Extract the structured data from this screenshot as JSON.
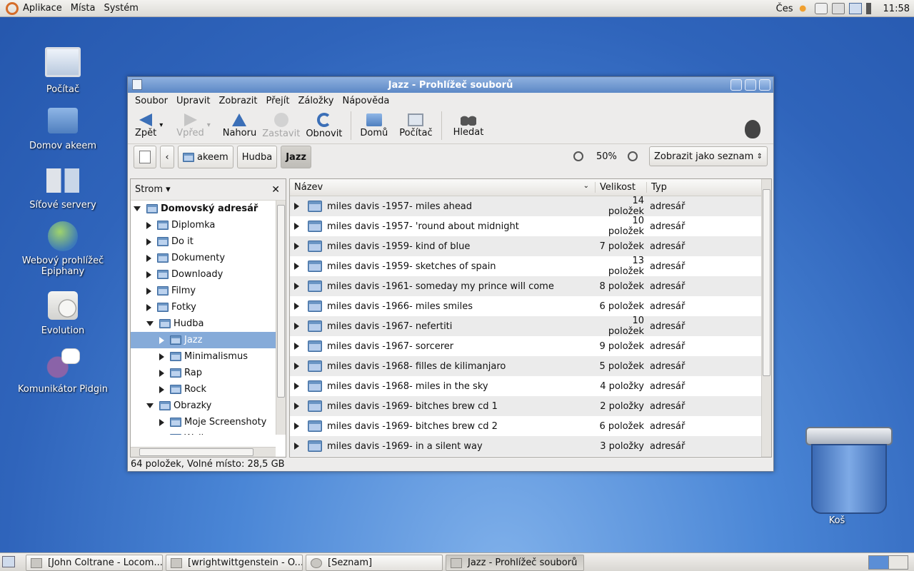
{
  "topbar": {
    "menus": [
      "Aplikace",
      "Místa",
      "Systém"
    ],
    "lang": "Čes",
    "clock": "11:58"
  },
  "desktop": {
    "icons": [
      {
        "label": "Počítač",
        "icon": "computer-icon"
      },
      {
        "label": "Domov akeem",
        "icon": "home-folder-icon"
      },
      {
        "label": "Síťové servery",
        "icon": "network-icon"
      },
      {
        "label": "Webový prohlížeč Epiphany",
        "icon": "globe-icon"
      },
      {
        "label": "Evolution",
        "icon": "mail-clock-icon"
      },
      {
        "label": "Komunikátor Pidgin",
        "icon": "pidgin-icon"
      }
    ],
    "trash_label": "Koš"
  },
  "window": {
    "title": "Jazz - Prohlížeč souborů",
    "menus": [
      "Soubor",
      "Upravit",
      "Zobrazit",
      "Přejít",
      "Záložky",
      "Nápověda"
    ],
    "toolbar": {
      "back": "Zpět",
      "forward": "Vpřed",
      "up": "Nahoru",
      "stop": "Zastavit",
      "reload": "Obnovit",
      "home": "Domů",
      "computer": "Počítač",
      "search": "Hledat"
    },
    "breadcrumbs": [
      "akeem",
      "Hudba",
      "Jazz"
    ],
    "zoom": "50%",
    "view_mode": "Zobrazit jako seznam",
    "sidebar": {
      "title": "Strom",
      "tree": [
        {
          "label": "Domovský adresář",
          "level": 0,
          "expanded": true,
          "bold": true
        },
        {
          "label": "Diplomka",
          "level": 1
        },
        {
          "label": "Do it",
          "level": 1
        },
        {
          "label": "Dokumenty",
          "level": 1
        },
        {
          "label": "Downloady",
          "level": 1
        },
        {
          "label": "Filmy",
          "level": 1
        },
        {
          "label": "Fotky",
          "level": 1
        },
        {
          "label": "Hudba",
          "level": 1,
          "expanded": true
        },
        {
          "label": "Jazz",
          "level": 2,
          "selected": true
        },
        {
          "label": "Minimalismus",
          "level": 2
        },
        {
          "label": "Rap",
          "level": 2
        },
        {
          "label": "Rock",
          "level": 2
        },
        {
          "label": "Obrazky",
          "level": 1,
          "expanded": true
        },
        {
          "label": "Moje Screenshoty",
          "level": 2
        },
        {
          "label": "Wallpapery",
          "level": 2
        }
      ]
    },
    "list": {
      "columns": [
        "Název",
        "Velikost",
        "Typ"
      ],
      "rows": [
        {
          "name": "miles davis -1957- miles ahead",
          "size": "14 položek",
          "type": "adresář"
        },
        {
          "name": "miles davis -1957- 'round about midnight",
          "size": "10 položek",
          "type": "adresář"
        },
        {
          "name": "miles davis -1959- kind of blue",
          "size": "7 položek",
          "type": "adresář"
        },
        {
          "name": "miles davis -1959- sketches of spain",
          "size": "13 položek",
          "type": "adresář"
        },
        {
          "name": "miles davis -1961- someday my prince will come",
          "size": "8 položek",
          "type": "adresář"
        },
        {
          "name": "miles davis -1966- miles smiles",
          "size": "6 položek",
          "type": "adresář"
        },
        {
          "name": "miles davis -1967- nefertiti",
          "size": "10 položek",
          "type": "adresář"
        },
        {
          "name": "miles davis -1967- sorcerer",
          "size": "9 položek",
          "type": "adresář"
        },
        {
          "name": "miles davis -1968- filles de kilimanjaro",
          "size": "5 položek",
          "type": "adresář"
        },
        {
          "name": "miles davis -1968- miles in the sky",
          "size": "4 položky",
          "type": "adresář"
        },
        {
          "name": "miles davis -1969- bitches brew cd 1",
          "size": "2 položky",
          "type": "adresář"
        },
        {
          "name": "miles davis -1969- bitches brew cd 2",
          "size": "6 položek",
          "type": "adresář"
        },
        {
          "name": "miles davis -1969- in a silent way",
          "size": "3 položky",
          "type": "adresář"
        }
      ]
    },
    "status": "64 položek, Volné místo: 28,5 GB"
  },
  "taskbar": {
    "tasks": [
      {
        "label": "[John Coltrane - Locom..."
      },
      {
        "label": "[wrightwittgenstein - O..."
      },
      {
        "label": "[Seznam]"
      },
      {
        "label": "Jazz - Prohlížeč souborů",
        "active": true
      }
    ]
  }
}
